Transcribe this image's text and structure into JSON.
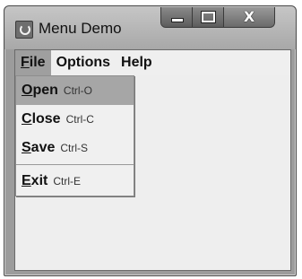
{
  "window": {
    "title": "Menu Demo",
    "controls": {
      "minimize": "minimize",
      "maximize": "maximize",
      "close": "X"
    }
  },
  "menubar": {
    "items": [
      {
        "label": "File",
        "mnemonic": "F",
        "rest": "ile",
        "open": true
      },
      {
        "label": "Options"
      },
      {
        "label": "Help"
      }
    ]
  },
  "file_menu": {
    "items": [
      {
        "mnemonic": "O",
        "rest": "pen",
        "shortcut": "Ctrl-O",
        "selected": true
      },
      {
        "mnemonic": "C",
        "rest": "lose",
        "shortcut": "Ctrl-C"
      },
      {
        "mnemonic": "S",
        "rest": "ave",
        "shortcut": "Ctrl-S"
      },
      {
        "mnemonic": "E",
        "rest": "xit",
        "shortcut": "Ctrl-E"
      }
    ]
  },
  "icons": {
    "app": "java-coffee-icon"
  },
  "colors": {
    "menu_highlight": "#9f9f9f",
    "background": "#eeeeee"
  }
}
